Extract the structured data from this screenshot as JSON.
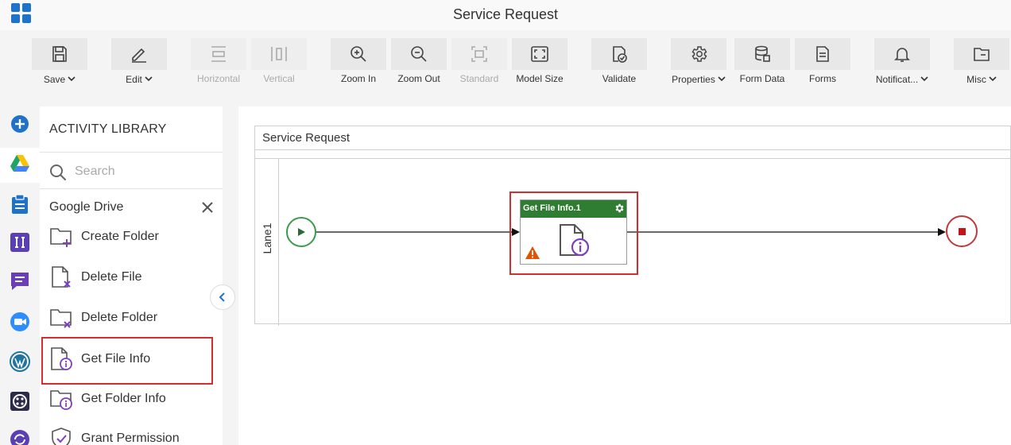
{
  "app": {
    "title": "Service Request"
  },
  "toolbar": {
    "items": [
      {
        "id": "save",
        "label": "Save",
        "icon": "save-icon",
        "caret": true,
        "disabled": false
      },
      {
        "id": "edit",
        "label": "Edit",
        "icon": "pencil-icon",
        "caret": true,
        "disabled": false
      },
      {
        "id": "horizontal",
        "label": "Horizontal",
        "icon": "horizontal-align-icon",
        "caret": false,
        "disabled": true
      },
      {
        "id": "vertical",
        "label": "Vertical",
        "icon": "vertical-align-icon",
        "caret": false,
        "disabled": true
      },
      {
        "id": "zoom-in",
        "label": "Zoom In",
        "icon": "zoom-in-icon",
        "caret": false,
        "disabled": false
      },
      {
        "id": "zoom-out",
        "label": "Zoom Out",
        "icon": "zoom-out-icon",
        "caret": false,
        "disabled": false
      },
      {
        "id": "standard",
        "label": "Standard",
        "icon": "standard-size-icon",
        "caret": false,
        "disabled": true
      },
      {
        "id": "model-size",
        "label": "Model Size",
        "icon": "model-size-icon",
        "caret": false,
        "disabled": false
      },
      {
        "id": "validate",
        "label": "Validate",
        "icon": "validate-icon",
        "caret": false,
        "disabled": false
      },
      {
        "id": "properties",
        "label": "Properties",
        "icon": "gear-icon",
        "caret": true,
        "disabled": false
      },
      {
        "id": "form-data",
        "label": "Form Data",
        "icon": "database-icon",
        "caret": false,
        "disabled": false
      },
      {
        "id": "forms",
        "label": "Forms",
        "icon": "forms-icon",
        "caret": false,
        "disabled": false
      },
      {
        "id": "notifications",
        "label": "Notificat...",
        "icon": "bell-icon",
        "caret": true,
        "disabled": false
      },
      {
        "id": "misc",
        "label": "Misc",
        "icon": "folder-icon",
        "caret": true,
        "disabled": false
      }
    ]
  },
  "rail": {
    "items": [
      {
        "name": "add-icon",
        "color": "#1e73c9"
      },
      {
        "name": "google-drive-icon",
        "color": "#1fa463"
      },
      {
        "name": "clipboard-icon",
        "color": "#1e73c9"
      },
      {
        "name": "text-i-icon",
        "color": "#5b3fb5"
      },
      {
        "name": "chat-icon",
        "color": "#6a3fb5"
      },
      {
        "name": "video-icon",
        "color": "#2d8cff"
      },
      {
        "name": "wordpress-icon",
        "color": "#21759b"
      },
      {
        "name": "twilio-icon",
        "color": "#2b2b4a"
      },
      {
        "name": "sync-icon",
        "color": "#5b3fb5"
      }
    ]
  },
  "library": {
    "title": "ACTIVITY LIBRARY",
    "search_placeholder": "Search",
    "group_title": "Google Drive",
    "items": [
      {
        "label": "Create Folder",
        "icon": "create-folder-icon"
      },
      {
        "label": "Delete File",
        "icon": "delete-file-icon"
      },
      {
        "label": "Delete Folder",
        "icon": "delete-folder-icon"
      },
      {
        "label": "Get File Info",
        "icon": "file-info-icon",
        "selected": true
      },
      {
        "label": "Get Folder Info",
        "icon": "folder-info-icon"
      },
      {
        "label": "Grant Permission",
        "icon": "grant-permission-icon"
      }
    ]
  },
  "canvas": {
    "pool_title": "Service Request",
    "lane_label": "Lane1",
    "task_name": "Get File Info.1"
  },
  "colors": {
    "accent": "#1e73c9",
    "task_header": "#2e7d32",
    "highlight": "#d32f2f",
    "start": "#3a9b4a",
    "end": "#c0393b",
    "warning": "#e65100",
    "activity_icon": "#7e3fbf"
  }
}
